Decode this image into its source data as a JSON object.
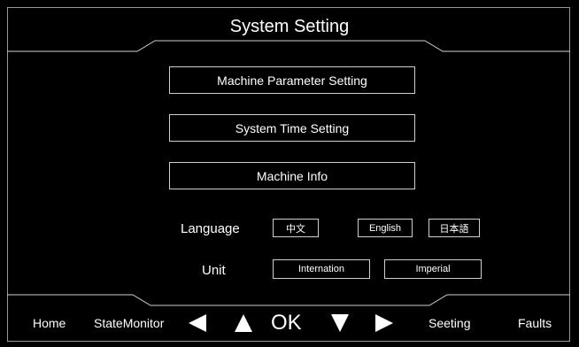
{
  "header": {
    "title": "System Setting"
  },
  "menu": {
    "machine_parameter": "Machine Parameter Setting",
    "system_time": "System Time Setting",
    "machine_info": "Machine Info"
  },
  "language": {
    "label": "Language",
    "options": [
      "中文",
      "English",
      "日本語"
    ]
  },
  "unit": {
    "label": "Unit",
    "options": [
      "Internation",
      "Imperial"
    ]
  },
  "navbar": {
    "home": "Home",
    "state_monitor": "StateMonitor",
    "left_icon": "left-arrow-icon",
    "up_icon": "up-arrow-icon",
    "ok": "OK",
    "down_icon": "down-arrow-icon",
    "right_icon": "right-arrow-icon",
    "seeting": "Seeting",
    "faults": "Faults"
  },
  "colors": {
    "background": "#000000",
    "foreground": "#ffffff",
    "border": "#cfcfcf"
  }
}
